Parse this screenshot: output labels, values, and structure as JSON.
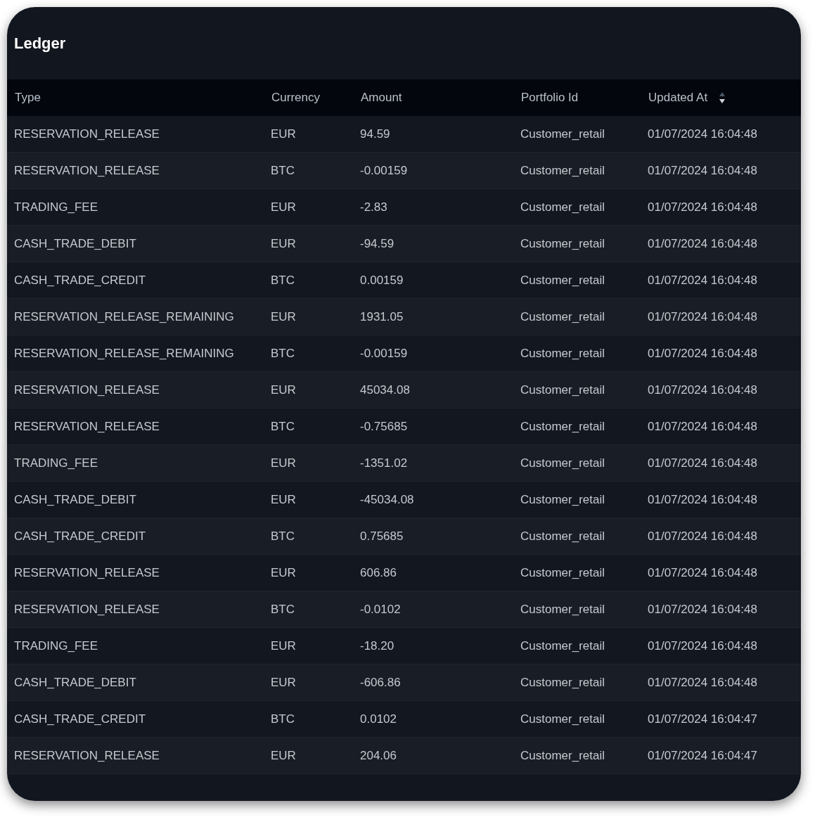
{
  "title": "Ledger",
  "table": {
    "columns": [
      {
        "label": "Type"
      },
      {
        "label": "Currency"
      },
      {
        "label": "Amount"
      },
      {
        "label": "Portfolio Id"
      },
      {
        "label": "Updated At",
        "sort_descending": true
      }
    ],
    "rows": [
      [
        "RESERVATION_RELEASE",
        "EUR",
        "94.59",
        "Customer_retail",
        "01/07/2024 16:04:48"
      ],
      [
        "RESERVATION_RELEASE",
        "BTC",
        "-0.00159",
        "Customer_retail",
        "01/07/2024 16:04:48"
      ],
      [
        "TRADING_FEE",
        "EUR",
        "-2.83",
        "Customer_retail",
        "01/07/2024 16:04:48"
      ],
      [
        "CASH_TRADE_DEBIT",
        "EUR",
        "-94.59",
        "Customer_retail",
        "01/07/2024 16:04:48"
      ],
      [
        "CASH_TRADE_CREDIT",
        "BTC",
        "0.00159",
        "Customer_retail",
        "01/07/2024 16:04:48"
      ],
      [
        "RESERVATION_RELEASE_REMAINING",
        "EUR",
        "1931.05",
        "Customer_retail",
        "01/07/2024 16:04:48"
      ],
      [
        "RESERVATION_RELEASE_REMAINING",
        "BTC",
        "-0.00159",
        "Customer_retail",
        "01/07/2024 16:04:48"
      ],
      [
        "RESERVATION_RELEASE",
        "EUR",
        "45034.08",
        "Customer_retail",
        "01/07/2024 16:04:48"
      ],
      [
        "RESERVATION_RELEASE",
        "BTC",
        "-0.75685",
        "Customer_retail",
        "01/07/2024 16:04:48"
      ],
      [
        "TRADING_FEE",
        "EUR",
        "-1351.02",
        "Customer_retail",
        "01/07/2024 16:04:48"
      ],
      [
        "CASH_TRADE_DEBIT",
        "EUR",
        "-45034.08",
        "Customer_retail",
        "01/07/2024 16:04:48"
      ],
      [
        "CASH_TRADE_CREDIT",
        "BTC",
        "0.75685",
        "Customer_retail",
        "01/07/2024 16:04:48"
      ],
      [
        "RESERVATION_RELEASE",
        "EUR",
        "606.86",
        "Customer_retail",
        "01/07/2024 16:04:48"
      ],
      [
        "RESERVATION_RELEASE",
        "BTC",
        "-0.0102",
        "Customer_retail",
        "01/07/2024 16:04:48"
      ],
      [
        "TRADING_FEE",
        "EUR",
        "-18.20",
        "Customer_retail",
        "01/07/2024 16:04:48"
      ],
      [
        "CASH_TRADE_DEBIT",
        "EUR",
        "-606.86",
        "Customer_retail",
        "01/07/2024 16:04:48"
      ],
      [
        "CASH_TRADE_CREDIT",
        "BTC",
        "0.0102",
        "Customer_retail",
        "01/07/2024 16:04:47"
      ],
      [
        "RESERVATION_RELEASE",
        "EUR",
        "204.06",
        "Customer_retail",
        "01/07/2024 16:04:47"
      ]
    ]
  }
}
